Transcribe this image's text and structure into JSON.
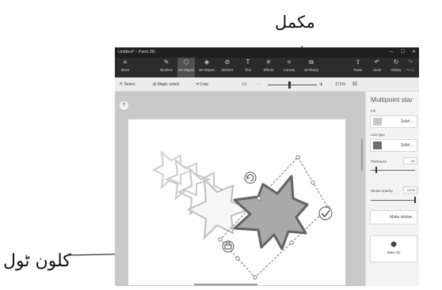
{
  "annotations": {
    "complete_label": "مکمل",
    "clone_tool_label": "کلون ٹول"
  },
  "window": {
    "title": "Untitled* - Paint 3D",
    "controls": [
      "—",
      "☐",
      "✕"
    ]
  },
  "ribbon": {
    "left": [
      {
        "icon": "≡",
        "label": "Menu"
      }
    ],
    "tools": [
      {
        "icon": "✎",
        "label": "Brushes"
      },
      {
        "icon": "⬡",
        "label": "2D shapes"
      },
      {
        "icon": "◈",
        "label": "3D shapes"
      },
      {
        "icon": "⊘",
        "label": "Stickers"
      },
      {
        "icon": "T",
        "label": "Text"
      },
      {
        "icon": "✳",
        "label": "Effects"
      },
      {
        "icon": "⌗",
        "label": "Canvas"
      },
      {
        "icon": "⧉",
        "label": "3D library"
      }
    ],
    "right": [
      {
        "icon": "⇪",
        "label": "Paste"
      },
      {
        "icon": "↶",
        "label": "Undo"
      },
      {
        "icon": "↻",
        "label": "History"
      },
      {
        "icon": "↷",
        "label": "Redo"
      }
    ],
    "active": "2D shapes"
  },
  "toolbar": {
    "select": "Select",
    "magic_select": "Magic select",
    "crop": "Crop",
    "zoom": "171%",
    "zoom_minus": "—",
    "zoom_plus": "+"
  },
  "panel": {
    "title": "Multipoint star",
    "fill_label": "Fill",
    "fill_value": "Solid",
    "line_type_label": "Line type",
    "line_type_value": "Solid",
    "thickness_label": "Thickness",
    "thickness_value": "7px",
    "opacity_label": "Stroke opacity",
    "opacity_value": "100%",
    "sticker_button": "Make sticker",
    "make3d_button": "Make 3D"
  },
  "colors": {
    "fill_swatch": "#c7c7c7",
    "line_swatch": "#6d6d6d",
    "star_fill": "#a9a9a9",
    "star_stroke": "#636363",
    "ghost_stroke": "#cfcfcf"
  },
  "help_icon": "?"
}
